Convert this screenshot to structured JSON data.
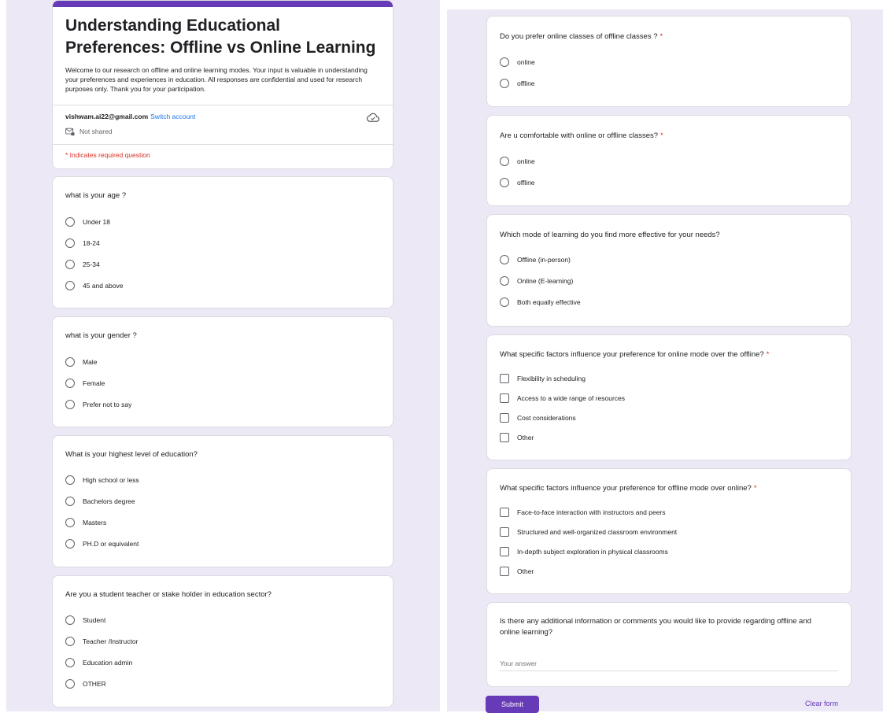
{
  "header": {
    "title": "Understanding Educational Preferences: Offline vs Online Learning",
    "description": "Welcome to our research on offline and online learning modes. Your input is valuable in understanding your preferences and experiences in education. All responses are confidential and used for research purposes only. Thank you for your participation.",
    "account_email": "vishwam.ai22@gmail.com",
    "switch_account": "Switch account",
    "not_shared": "Not shared",
    "required_note": "* Indicates required question"
  },
  "questions": {
    "age": {
      "title": "what is your age ?",
      "options": [
        "Under 18",
        "18-24",
        "25-34",
        "45 and above"
      ]
    },
    "gender": {
      "title": "what is your gender ?",
      "options": [
        "Male",
        "Female",
        "Prefer not to say"
      ]
    },
    "education": {
      "title": "What is your highest level of education?",
      "options": [
        "High school or less",
        "Bachelors degree",
        "Masters",
        "PH.D or equivalent"
      ]
    },
    "role": {
      "title": "Are you a student teacher or stake holder in education sector?",
      "options": [
        "Student",
        "Teacher /Instructor",
        "Education admin",
        "OTHER"
      ]
    },
    "prefer": {
      "title": "Do you  prefer online classes of offline classes ?",
      "required": "*",
      "options": [
        "online",
        "offline"
      ]
    },
    "comfortable": {
      "title": "Are u comfortable with online or offline classes?",
      "required": "*",
      "options": [
        "online",
        "offline"
      ]
    },
    "effective": {
      "title": "Which mode of learning do you find more effective for your needs?",
      "options": [
        "Offline (in-person)",
        "Online (E-learning)",
        "Both equally effective"
      ]
    },
    "online_factors": {
      "title": "What specific factors influence your preference for online mode over the offline?",
      "required": "*",
      "options": [
        "Flexibility in scheduling",
        "Access to a wide range of resources",
        "Cost considerations",
        "Other"
      ]
    },
    "offline_factors": {
      "title": "What specific factors influence your preference for offline mode over online?",
      "required": "*",
      "options": [
        "Face-to-face interaction with instructors and peers",
        "Structured and well-organized classroom environment",
        "In-depth subject exploration in physical classrooms",
        "Other"
      ]
    },
    "comments": {
      "title": "Is there any additional information or comments you would like to provide regarding offline and online learning?",
      "placeholder": "Your answer"
    }
  },
  "footer": {
    "submit_label": "Submit",
    "clear_label": "Clear form"
  },
  "colors": {
    "accent": "#673ab7",
    "link": "#1a73e8",
    "required": "#d93025",
    "background": "#ece8f5"
  },
  "icons": [
    "cloud-check-icon",
    "mail-lock-icon"
  ]
}
